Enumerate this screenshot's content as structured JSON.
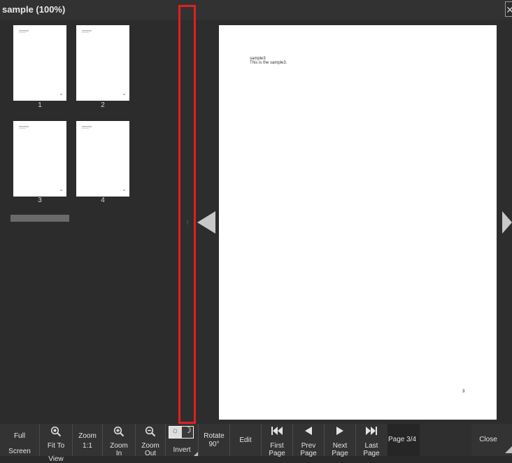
{
  "window": {
    "title": "sample (100%)",
    "close_glyph": "✕"
  },
  "sidebar": {
    "thumbnails": [
      {
        "label": "1"
      },
      {
        "label": "2"
      },
      {
        "label": "3"
      },
      {
        "label": "4"
      }
    ]
  },
  "splitter": {
    "marker": "I"
  },
  "document": {
    "page": {
      "line1": "sample3",
      "line2": "This is the sample3.",
      "footer_number": "3"
    }
  },
  "nav": {
    "prev_icon": "triangle-left-icon",
    "next_icon": "triangle-right-icon"
  },
  "toolbar": {
    "full_screen": [
      "Full",
      "Screen"
    ],
    "fit_to_view": [
      "Fit To",
      "View"
    ],
    "zoom_1_1": [
      "Zoom",
      "1:1"
    ],
    "zoom_in": [
      "Zoom",
      "In"
    ],
    "zoom_out": [
      "Zoom",
      "Out"
    ],
    "invert": "Invert",
    "rotate": [
      "Rotate",
      "90°"
    ],
    "edit": "Edit",
    "first_page": [
      "First",
      "Page"
    ],
    "prev_page": [
      "Prev",
      "Page"
    ],
    "next_page": [
      "Next",
      "Page"
    ],
    "last_page": [
      "Last",
      "Page"
    ],
    "page_indicator": "Page 3/4",
    "close": "Close"
  },
  "colors": {
    "highlight": "#e02020",
    "background": "#2a2a2a",
    "page": "#ffffff"
  }
}
